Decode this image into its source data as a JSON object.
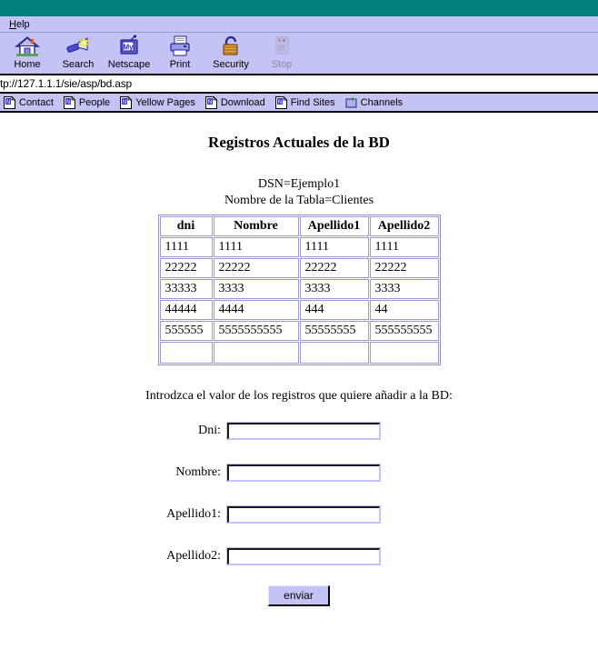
{
  "browser": {
    "menu": [
      {
        "label": "Help",
        "accel": "H"
      }
    ],
    "toolbar": [
      {
        "label": "Home",
        "icon": "home-icon",
        "disabled": false
      },
      {
        "label": "Search",
        "icon": "search-flashlight-icon",
        "disabled": false
      },
      {
        "label": "Netscape",
        "icon": "netscape-my-icon",
        "disabled": false
      },
      {
        "label": "Print",
        "icon": "printer-icon",
        "disabled": false
      },
      {
        "label": "Security",
        "icon": "padlock-icon",
        "disabled": false
      },
      {
        "label": "Stop",
        "icon": "stop-sign-icon",
        "disabled": true
      }
    ],
    "url": "tp://127.1.1.1/sie/asp/bd.asp",
    "bookmarks": [
      {
        "label": "Contact",
        "icon": "netscape-page-icon"
      },
      {
        "label": "People",
        "icon": "netscape-page-icon"
      },
      {
        "label": "Yellow Pages",
        "icon": "netscape-page-icon"
      },
      {
        "label": "Download",
        "icon": "netscape-page-icon"
      },
      {
        "label": "Find Sites",
        "icon": "netscape-page-icon"
      },
      {
        "label": "Channels",
        "icon": "channels-icon"
      }
    ]
  },
  "page": {
    "title": "Registros Actuales de la BD",
    "dsn_line": "DSN=Ejemplo1",
    "table_line": "Nombre de la Tabla=Clientes",
    "table": {
      "headers": [
        "dni",
        "Nombre",
        "Apellido1",
        "Apellido2"
      ],
      "rows": [
        [
          "1111",
          "1111",
          "1111",
          "1111"
        ],
        [
          "22222",
          "22222",
          "22222",
          "22222"
        ],
        [
          "33333",
          "3333",
          "3333",
          "3333"
        ],
        [
          "44444",
          "4444",
          "444",
          "44"
        ],
        [
          "555555",
          "5555555555",
          "55555555",
          "555555555"
        ],
        [
          "",
          "",
          "",
          ""
        ]
      ]
    },
    "form": {
      "prompt": "Introdzca el valor de los registros que quiere añadir a la BD:",
      "fields": [
        {
          "label": "Dni:",
          "value": "",
          "placeholder": ""
        },
        {
          "label": "Nombre:",
          "value": "",
          "placeholder": ""
        },
        {
          "label": "Apellido1:",
          "value": "",
          "placeholder": ""
        },
        {
          "label": "Apellido2:",
          "value": "",
          "placeholder": ""
        }
      ],
      "submit_label": "enviar"
    }
  },
  "colors": {
    "titlebar": "#007f7f",
    "chrome": "#c3c3f5",
    "table_border": "#9a9ad4",
    "page_bg": "#ffffff"
  }
}
